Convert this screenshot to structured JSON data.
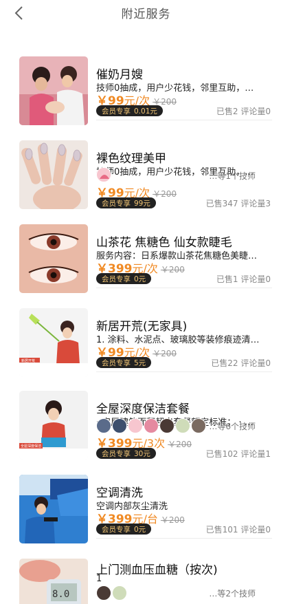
{
  "header": {
    "title": "附近服务"
  },
  "services": [
    {
      "name": "催奶月嫂",
      "desc": "技师0抽成，用户少花钱，邻里互助，…",
      "price": "￥99",
      "unit": "元/次",
      "orig": "￥200",
      "vip_label": "会员专享",
      "vip_price": "0.01元",
      "sold": "已售2",
      "comments": "评论量0",
      "has_avatars": false,
      "thumb": "nursing-photo"
    },
    {
      "name": "裸色纹理美甲",
      "desc": "技师0抽成，用户少花钱，邻里互助，…",
      "price": "￥99",
      "unit": "元/次",
      "orig": "￥200",
      "vip_label": "会员专享",
      "vip_price": "99元",
      "sold": "已售347",
      "comments": "评论量3",
      "has_avatars": true,
      "technicians": "…等1个技师",
      "thumb": "nails-photo"
    },
    {
      "name": "山茶花 焦糖色 仙女款睫毛",
      "desc": "服务内容：日系爆款山茶花焦糖色美睫…",
      "price": "￥399",
      "unit": "元/次",
      "orig": "￥200",
      "vip_label": "会员专享",
      "vip_price": "0元",
      "sold": "已售1",
      "comments": "评论量0",
      "has_avatars": false,
      "thumb": "eyelash-photo"
    },
    {
      "name": "新居开荒(无家具)",
      "desc": "1. 涂料、水泥点、玻璃胶等装修痕迹清…",
      "price": "￥99",
      "unit": "元/次",
      "orig": "￥200",
      "vip_label": "会员专享",
      "vip_price": "5元",
      "sold": "已售22",
      "comments": "评论量0",
      "has_avatars": false,
      "thumb": "cleaning-photo",
      "thumb_caption": "新居开荒"
    },
    {
      "name": "全屋深度保洁套餐",
      "desc": "· 房屋建筑面积超出套餐额定标准；  · …",
      "price": "￥399",
      "unit": "元/3次",
      "orig": "￥200",
      "vip_label": "会员专享",
      "vip_price": "30元",
      "sold": "已售102",
      "comments": "评论量1",
      "has_avatars": true,
      "technicians": "…等6个技师",
      "thumb": "deep-cleaning-photo",
      "thumb_caption": "全屋深度保洁"
    },
    {
      "name": "空调清洗",
      "desc": "空调内部灰尘清洗",
      "price": "￥399",
      "unit": "元/台",
      "orig": "￥200",
      "vip_label": "会员专享",
      "vip_price": "0元",
      "sold": "已售101",
      "comments": "评论量0",
      "has_avatars": false,
      "thumb": "aircon-photo"
    },
    {
      "name": "上门测血压血糖（按次)",
      "desc": "1",
      "has_avatars": true,
      "technicians": "…等2个技师",
      "thumb": "blood-test-photo"
    }
  ],
  "colors": {
    "price": "#f08a24",
    "vip_bg": "#222222",
    "vip_text": "#f3c574"
  }
}
